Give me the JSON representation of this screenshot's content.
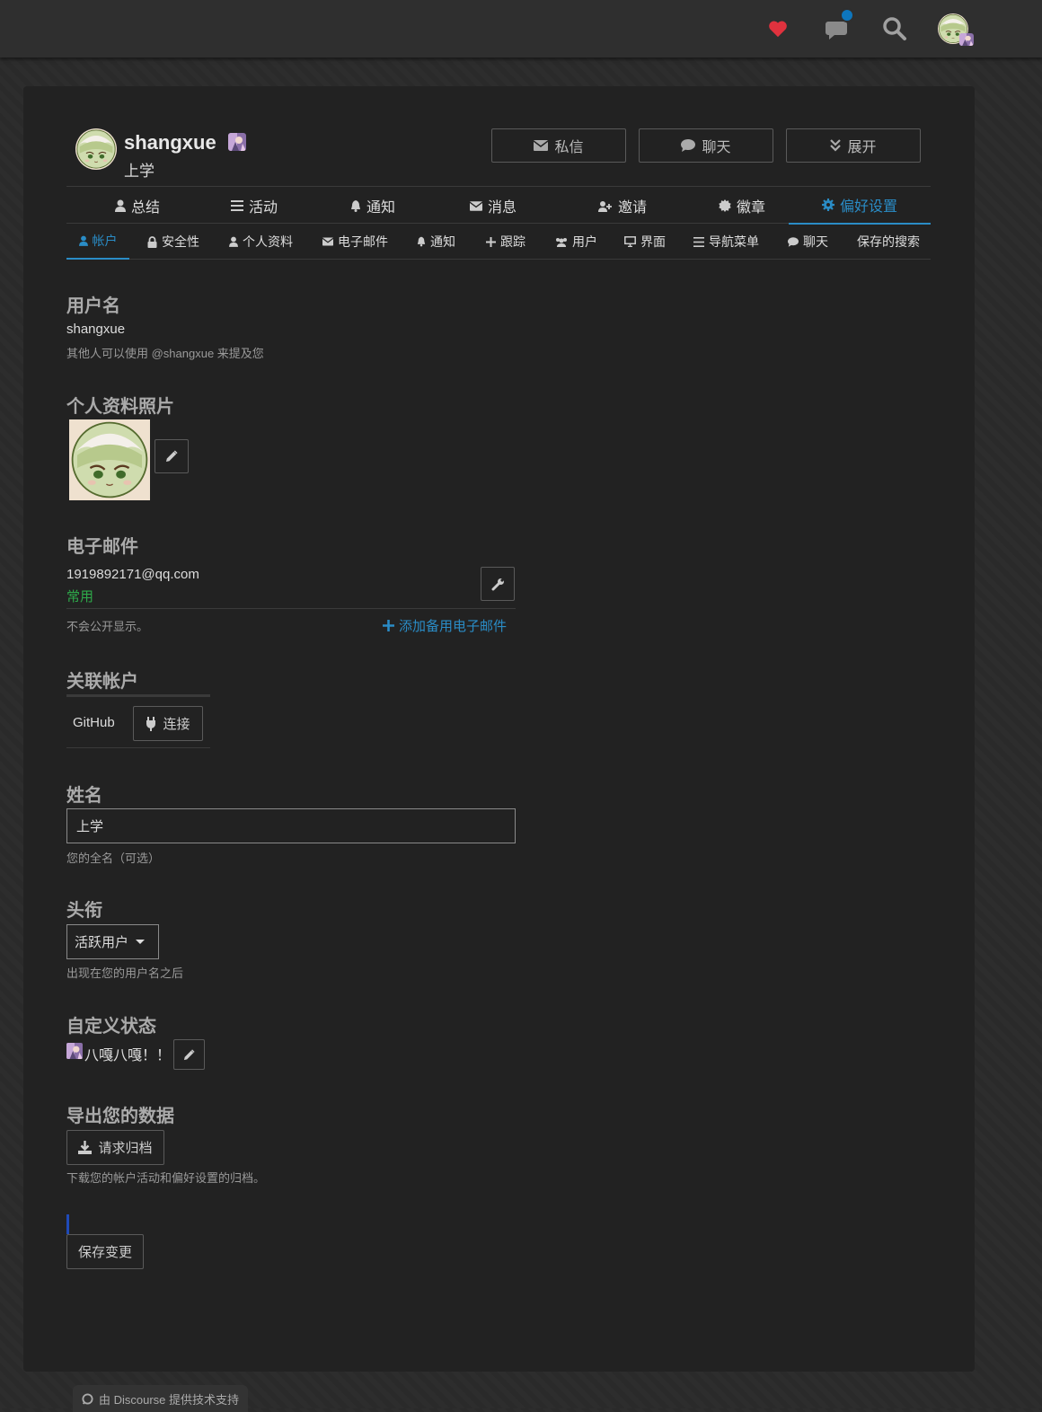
{
  "colors": {
    "accent": "#2a8cc6",
    "heart": "#e0323e",
    "notification_dot": "#0e76bd",
    "verified_green": "#2eaa4a",
    "panel_bg": "#222222",
    "page_bg": "#2b2b2b"
  },
  "topbar": {
    "icons": [
      "heart-icon",
      "chat-icon",
      "search-icon",
      "user-avatar"
    ]
  },
  "profile": {
    "username": "shangxue",
    "full_name": "上学"
  },
  "header_buttons": {
    "message": "私信",
    "chat": "聊天",
    "expand": "展开"
  },
  "main_nav": [
    {
      "label": "总结",
      "icon": "user-icon"
    },
    {
      "label": "活动",
      "icon": "list-icon"
    },
    {
      "label": "通知",
      "icon": "bell-icon"
    },
    {
      "label": "消息",
      "icon": "envelope-icon"
    },
    {
      "label": "邀请",
      "icon": "user-plus-icon"
    },
    {
      "label": "徽章",
      "icon": "certificate-icon"
    },
    {
      "label": "偏好设置",
      "icon": "gear-icon",
      "active": true
    }
  ],
  "pref_nav": [
    {
      "label": "帐户",
      "icon": "user-icon",
      "active": true
    },
    {
      "label": "安全性",
      "icon": "lock-icon"
    },
    {
      "label": "个人资料",
      "icon": "user-icon"
    },
    {
      "label": "电子邮件",
      "icon": "envelope-icon"
    },
    {
      "label": "通知",
      "icon": "bell-icon"
    },
    {
      "label": "跟踪",
      "icon": "plus-icon"
    },
    {
      "label": "用户",
      "icon": "users-icon"
    },
    {
      "label": "界面",
      "icon": "desktop-icon"
    },
    {
      "label": "导航菜单",
      "icon": "bars-icon"
    },
    {
      "label": "聊天",
      "icon": "comment-icon"
    },
    {
      "label": "保存的搜索",
      "icon": ""
    }
  ],
  "account": {
    "username_title": "用户名",
    "username_value": "shangxue",
    "username_help": "其他人可以使用 @shangxue 来提及您",
    "photo_title": "个人资料照片",
    "email_title": "电子邮件",
    "email_value": "1919892171@qq.com",
    "email_primary": "常用",
    "email_help": "不会公开显示。",
    "email_add_link": "添加备用电子邮件",
    "linked_title": "关联帐户",
    "linked_provider": "GitHub",
    "linked_connect": "连接",
    "name_title": "姓名",
    "name_value": "上学",
    "name_help": "您的全名（可选）",
    "title_title": "头衔",
    "title_value": "活跃用户",
    "title_help": "出现在您的用户名之后",
    "status_title": "自定义状态",
    "status_value": "八嘎八嘎！！",
    "export_title": "导出您的数据",
    "export_button": "请求归档",
    "export_help": "下载您的帐户活动和偏好设置的归档。",
    "save_button": "保存变更"
  },
  "footer": {
    "powered_by": "由 Discourse 提供技术支持"
  }
}
